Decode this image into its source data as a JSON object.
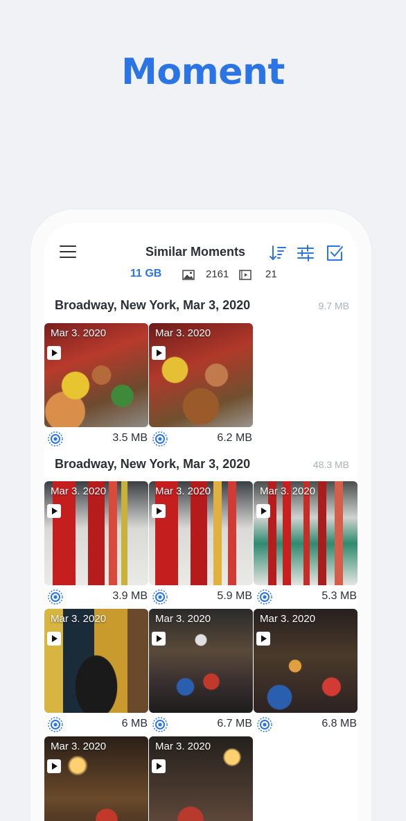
{
  "hero": {
    "title": "Moment"
  },
  "header": {
    "title": "Similar Moments",
    "icons": [
      "menu-icon",
      "sort-icon",
      "filter-icon",
      "select-all-icon"
    ]
  },
  "stats": {
    "total_size": "11 GB",
    "image_count": "2161",
    "video_count": "21"
  },
  "groups": [
    {
      "title": "Broadway, New York, Mar 3, 2020",
      "size": "9.7 MB",
      "items": [
        {
          "date": "Mar 3. 2020",
          "size": "3.5 MB",
          "scene": "figures"
        },
        {
          "date": "Mar 3. 2020",
          "size": "6.2 MB",
          "scene": "figures"
        }
      ]
    },
    {
      "title": "Broadway, New York, Mar 3, 2020",
      "size": "48.3 MB",
      "items": [
        {
          "date": "Mar 3. 2020",
          "size": "3.9 MB",
          "scene": "bottles"
        },
        {
          "date": "Mar 3. 2020",
          "size": "5.9 MB",
          "scene": "bottles"
        },
        {
          "date": "Mar 3. 2020",
          "size": "5.3 MB",
          "scene": "shelf"
        },
        {
          "date": "Mar 3. 2020",
          "size": "6 MB",
          "scene": "statue"
        },
        {
          "date": "Mar 3. 2020",
          "size": "6.7 MB",
          "scene": "ceiling"
        },
        {
          "date": "Mar 3. 2020",
          "size": "6.8 MB",
          "scene": "ceiling"
        },
        {
          "date": "Mar 3. 2020",
          "size": "",
          "scene": "lamp"
        },
        {
          "date": "Mar 3. 2020",
          "size": "",
          "scene": "store"
        }
      ]
    }
  ],
  "colors": {
    "accent": "#2a74e6",
    "background": "#f1f2f5"
  }
}
